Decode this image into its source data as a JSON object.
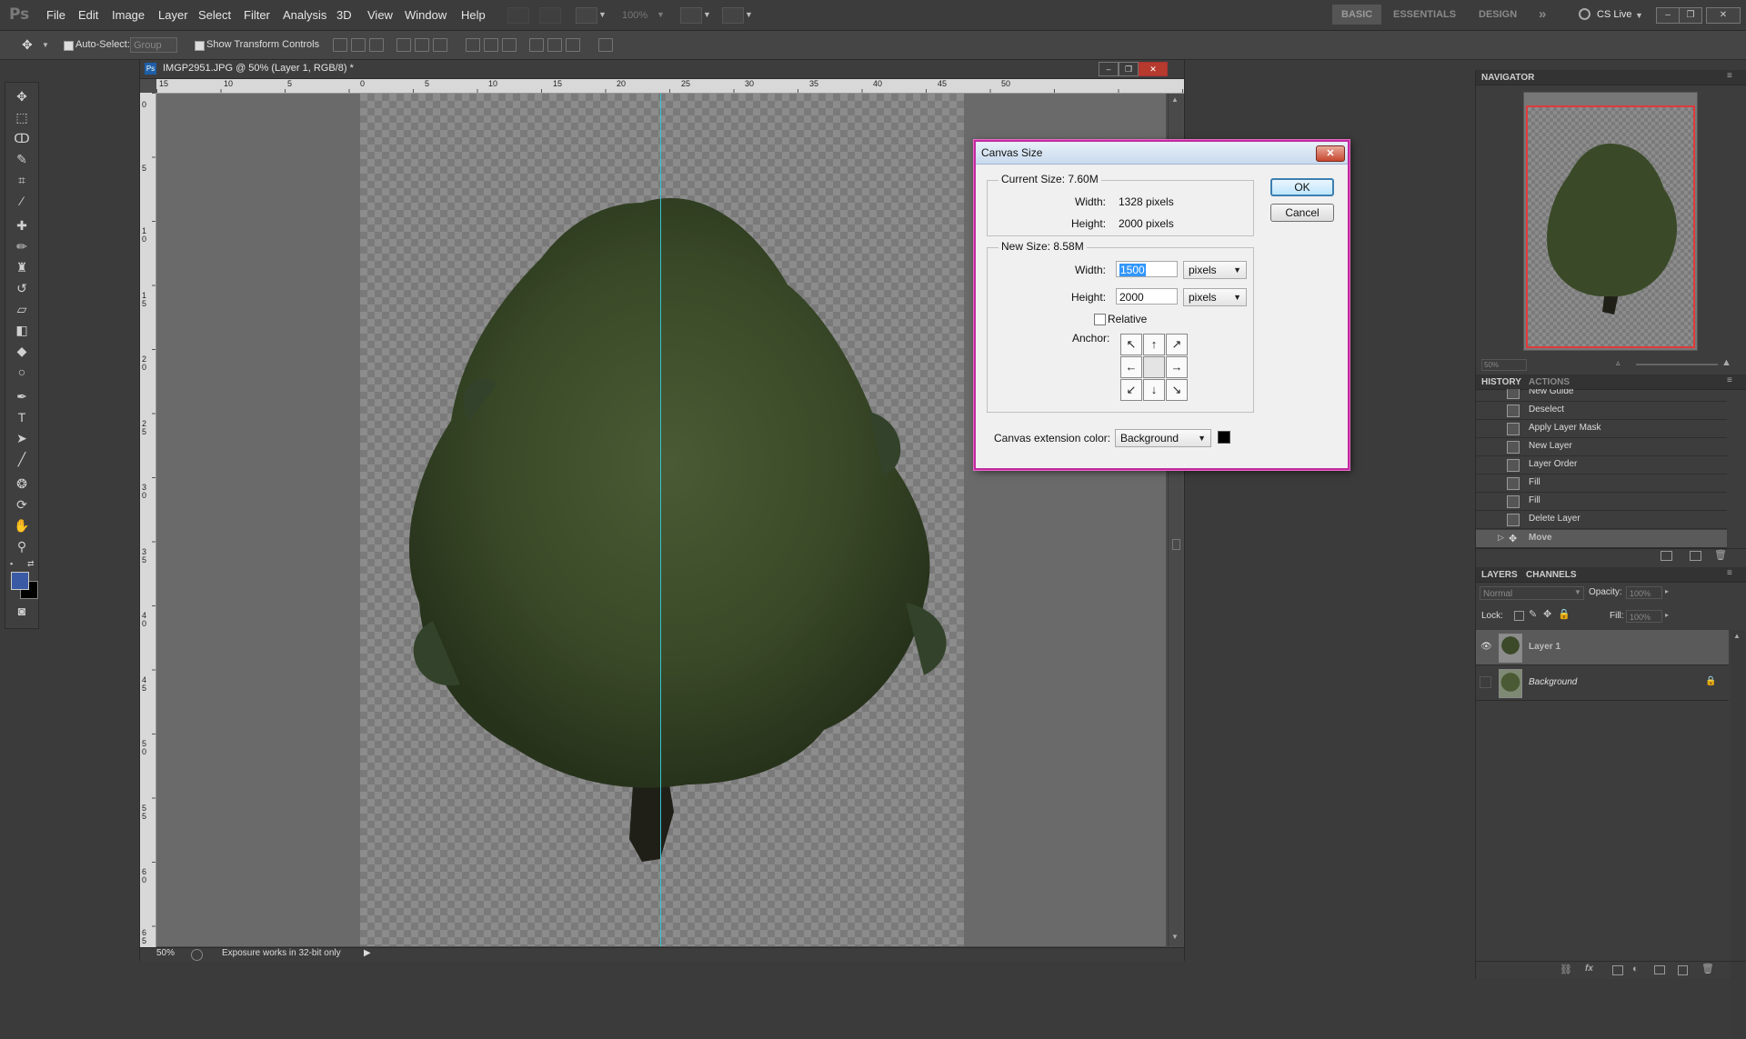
{
  "app": {
    "logo": "Ps"
  },
  "menu": [
    "File",
    "Edit",
    "Image",
    "Layer",
    "Select",
    "Filter",
    "Analysis",
    "3D",
    "View",
    "Window",
    "Help"
  ],
  "appbar": {
    "zoom": "100%"
  },
  "workspaces": [
    "BASIC",
    "ESSENTIALS",
    "DESIGN"
  ],
  "workspaces_more": "»",
  "cslive": "CS Live",
  "options_bar": {
    "auto_select_label": "Auto-Select:",
    "auto_select_value": "Group",
    "show_transform_label": "Show Transform Controls"
  },
  "document": {
    "title": "IMGP2951.JPG @ 50% (Layer 1, RGB/8) *",
    "zoom": "50%",
    "status": "Exposure works in 32-bit only",
    "ruler_h": [
      "15",
      "10",
      "5",
      "0",
      "5",
      "10",
      "15",
      "20",
      "25",
      "30",
      "35",
      "40",
      "45",
      "50"
    ],
    "ruler_v": [
      "0",
      "5",
      "1\n0",
      "1\n5",
      "2\n0",
      "2\n5",
      "3\n0",
      "3\n5",
      "4\n0",
      "4\n5",
      "5\n0",
      "5\n5",
      "6\n0",
      "6\n5"
    ]
  },
  "navigator": {
    "tab": "NAVIGATOR",
    "zoom": "50%"
  },
  "history": {
    "tabs": [
      "HISTORY",
      "ACTIONS"
    ],
    "items": [
      "New Guide",
      "Deselect",
      "Apply Layer Mask",
      "New Layer",
      "Layer Order",
      "Fill",
      "Fill",
      "Delete Layer",
      "Move"
    ]
  },
  "layers": {
    "tabs": [
      "LAYERS",
      "CHANNELS"
    ],
    "blend_mode": "Normal",
    "opacity_label": "Opacity:",
    "opacity_value": "100%",
    "lock_label": "Lock:",
    "fill_label": "Fill:",
    "fill_value": "100%",
    "items": [
      {
        "name": "Layer 1",
        "visible": true,
        "selected": true
      },
      {
        "name": "Background",
        "visible": false,
        "locked": true
      }
    ]
  },
  "dialog": {
    "title": "Canvas Size",
    "current_size_label": "Current Size: 7.60M",
    "current_width_label": "Width:",
    "current_width_value": "1328 pixels",
    "current_height_label": "Height:",
    "current_height_value": "2000 pixels",
    "new_size_label": "New Size: 8.58M",
    "width_label": "Width:",
    "width_value": "1500",
    "width_unit": "pixels",
    "height_label": "Height:",
    "height_value": "2000",
    "height_unit": "pixels",
    "relative_label": "Relative",
    "anchor_label": "Anchor:",
    "extension_color_label": "Canvas extension color:",
    "extension_color_value": "Background",
    "ok_label": "OK",
    "cancel_label": "Cancel",
    "extension_swatch_color": "#000000"
  },
  "colors": {
    "foreground": "#3b5aa6",
    "background": "#000000",
    "guide": "#35c3d6",
    "dialog_border": "#c02a9f"
  }
}
